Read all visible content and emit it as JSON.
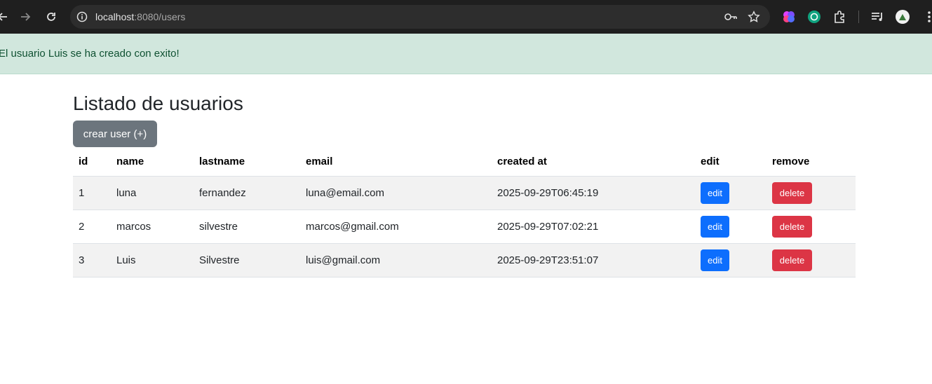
{
  "browser": {
    "url_host": "localhost",
    "url_path": ":8080/users",
    "nav_icons": [
      "back-arrow-icon",
      "forward-arrow-icon",
      "reload-icon"
    ],
    "omnibox_icons": [
      "site-info-icon",
      "password-key-icon",
      "bookmark-star-icon"
    ],
    "extension_icons": [
      "brain-extension-icon",
      "openai-extension-icon",
      "extensions-puzzle-icon",
      "media-queue-icon",
      "profile-avatar-icon",
      "menu-kebab-icon"
    ]
  },
  "alert": {
    "message": "El usuario Luis se ha creado con exito!",
    "color": "#d1e7dd"
  },
  "page": {
    "title": "Listado de usuarios",
    "create_button": "crear user (+)"
  },
  "table": {
    "headers": {
      "id": "id",
      "name": "name",
      "lastname": "lastname",
      "email": "email",
      "created_at": "created at",
      "edit": "edit",
      "remove": "remove"
    },
    "rows": [
      {
        "id": "1",
        "name": "luna",
        "lastname": "fernandez",
        "email": "luna@email.com",
        "created_at": "2025-09-29T06:45:19",
        "edit": "edit",
        "delete": "delete"
      },
      {
        "id": "2",
        "name": "marcos",
        "lastname": "silvestre",
        "email": "marcos@gmail.com",
        "created_at": "2025-09-29T07:02:21",
        "edit": "edit",
        "delete": "delete"
      },
      {
        "id": "3",
        "name": "Luis",
        "lastname": "Silvestre",
        "email": "luis@gmail.com",
        "created_at": "2025-09-29T23:51:07",
        "edit": "edit",
        "delete": "delete"
      }
    ]
  },
  "colors": {
    "edit_button": "#0d6efd",
    "delete_button": "#dc3545",
    "create_button": "#6c757d"
  }
}
